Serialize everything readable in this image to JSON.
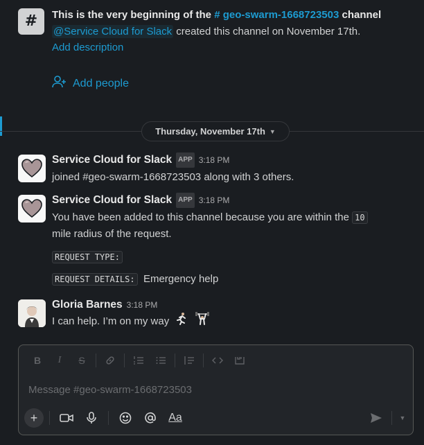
{
  "intro": {
    "title_prefix": "This is the very beginning of the ",
    "channel_link": "# geo-swarm-1668723503",
    "title_suffix": " channel",
    "creator_mention": "@Service Cloud for Slack",
    "created_text": " created this channel on November 17th.",
    "add_description": "Add description",
    "add_people": "Add people"
  },
  "date_divider": {
    "label": "Thursday, November 17th"
  },
  "messages": [
    {
      "sender": "Service Cloud for Slack",
      "badge": "APP",
      "time": "3:18 PM",
      "text": "joined #geo-swarm-1668723503 along with 3 others."
    },
    {
      "sender": "Service Cloud for Slack",
      "badge": "APP",
      "time": "3:18 PM",
      "text_before": "You have been added to this channel because you are within the ",
      "code_value": "10",
      "text_after": "mile radius of the request.",
      "fields": [
        {
          "label": "REQUEST TYPE:",
          "value": ""
        },
        {
          "label": "REQUEST DETAILS:",
          "value": "Emergency help"
        }
      ]
    },
    {
      "sender": "Gloria Barnes",
      "time": "3:18 PM",
      "text": "I can help. I’m on my way",
      "emoji": [
        "runner-emoji",
        "weightlifter-emoji"
      ]
    }
  ],
  "composer": {
    "placeholder": "Message #geo-swarm-1668723503",
    "format_aa": "Aa"
  },
  "colors": {
    "background": "#1a1d21",
    "link": "#1d9bd1",
    "text": "#d1d2d3"
  }
}
